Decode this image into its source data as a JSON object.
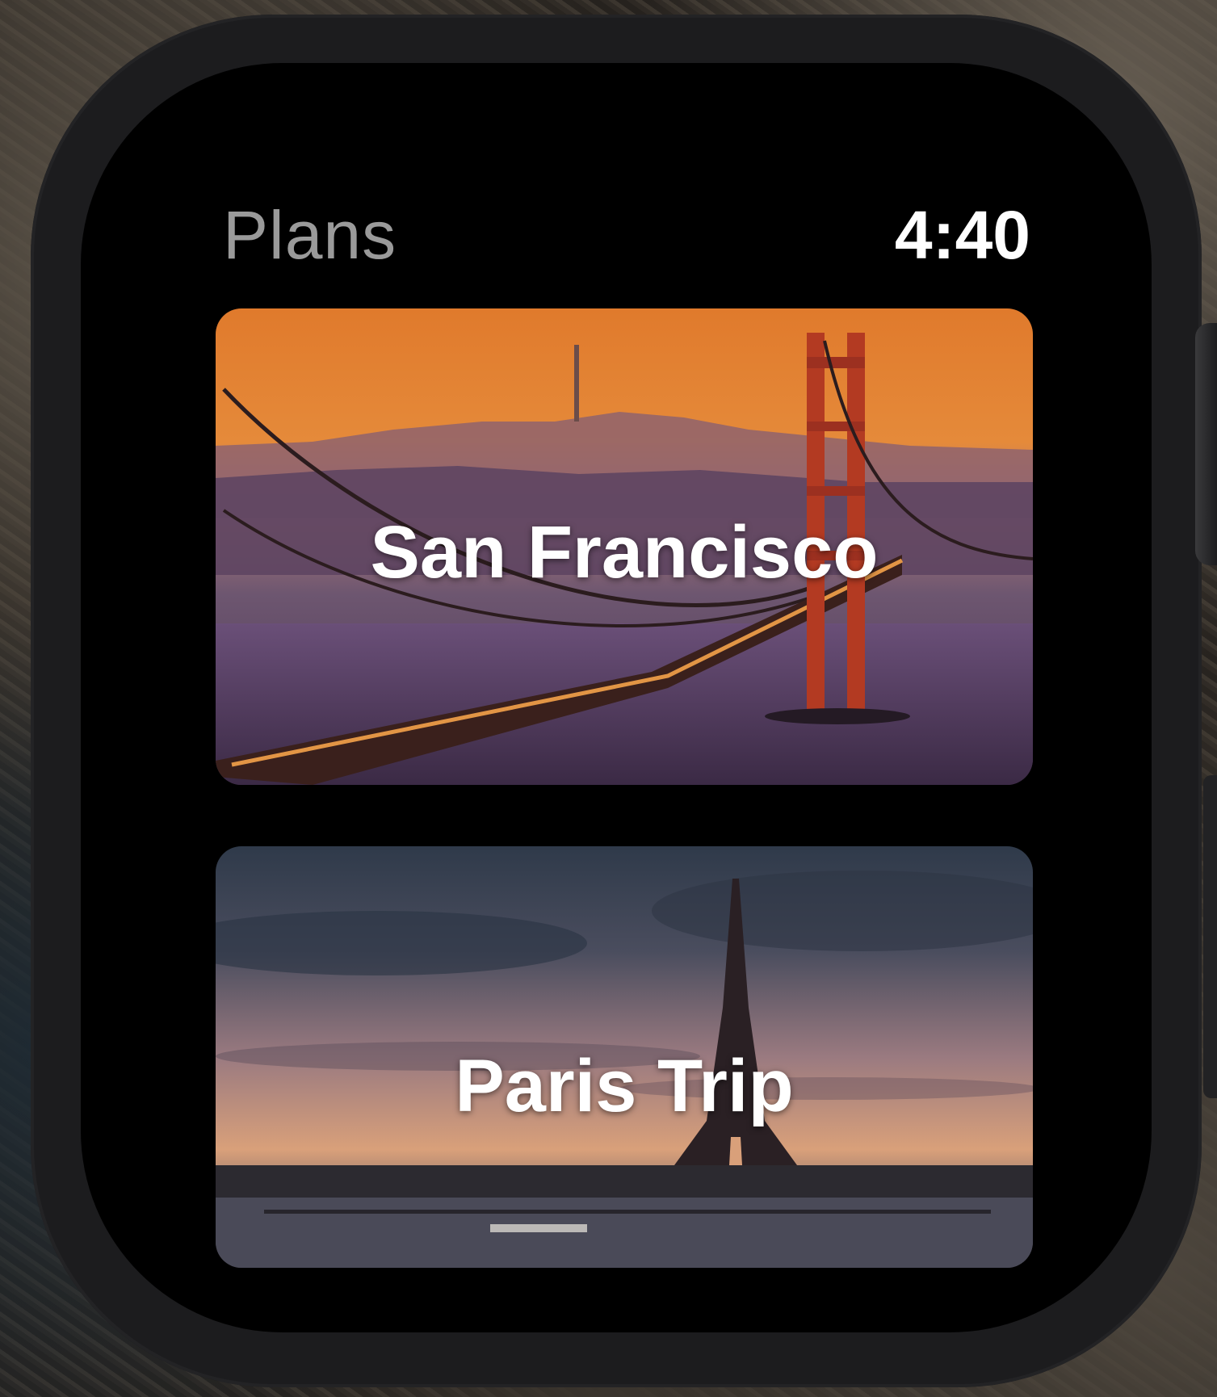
{
  "header": {
    "title": "Plans",
    "time": "4:40"
  },
  "plans": [
    {
      "label": "San Francisco",
      "image": "golden-gate-bridge-sunset"
    },
    {
      "label": "Paris Trip",
      "image": "eiffel-tower-dusk"
    }
  ],
  "colors": {
    "title_gray": "#9a9a9a",
    "time_white": "#ffffff",
    "screen_black": "#000000",
    "case_dark": "#1c1c1e"
  }
}
